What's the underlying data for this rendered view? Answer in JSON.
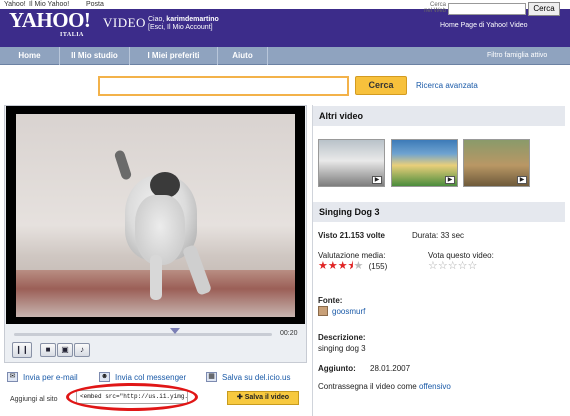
{
  "topbar": {
    "links": [
      "Yahoo!",
      "Il Mio Yahoo!",
      "Posta"
    ]
  },
  "header": {
    "logo": "YAHOO!",
    "logo_sub": "ITALIA",
    "product": "VIDEO",
    "greeting": "Ciao,",
    "username": "karimdemartino",
    "account_links": "[Esci, Il Mio Account]",
    "web_search_label": "Cerca nel Web",
    "web_search_button": "Cerca",
    "home_links": "Home Page di Yahoo! Video"
  },
  "nav": {
    "items": [
      "Home",
      "Il Mio studio",
      "I Miei preferiti",
      "Aiuto"
    ],
    "filter": "Filtro famiglia attivo"
  },
  "search": {
    "button": "Cerca",
    "advanced": "Ricerca avanzata",
    "value": ""
  },
  "player": {
    "timecode": "00:20",
    "progress_fraction": 0.62
  },
  "share": {
    "email": "Invia per e-mail",
    "messenger": "Invia col messenger",
    "delicious": "Salva su del.icio.us",
    "add_to_site": "Aggiungi al sito",
    "embed_code": "<embed src=\"http://us.i1.yimg.com",
    "save_button": "Salva il video"
  },
  "sidebar": {
    "other_videos_title": "Altri video",
    "video_title": "Singing Dog 3",
    "views": "Visto 21.153 volte",
    "duration": "Durata: 33 sec",
    "rating_label": "Valutazione media:",
    "rating_count": "(155)",
    "rating_value": 3.5,
    "vote_label": "Vota questo video:",
    "source_label": "Fonte:",
    "source_user": "goosmurf",
    "description_label": "Descrizione:",
    "description": "singing dog 3",
    "added_label": "Aggiunto:",
    "added_date": "28.01.2007",
    "flag_text": "Contrassegna il video come",
    "flag_link": "offensivo"
  },
  "colors": {
    "brand": "#3c2c8a",
    "nav": "#8fa3bf",
    "accent": "#f7c13c",
    "link": "#1a5aa8",
    "rating": "#e02424"
  }
}
